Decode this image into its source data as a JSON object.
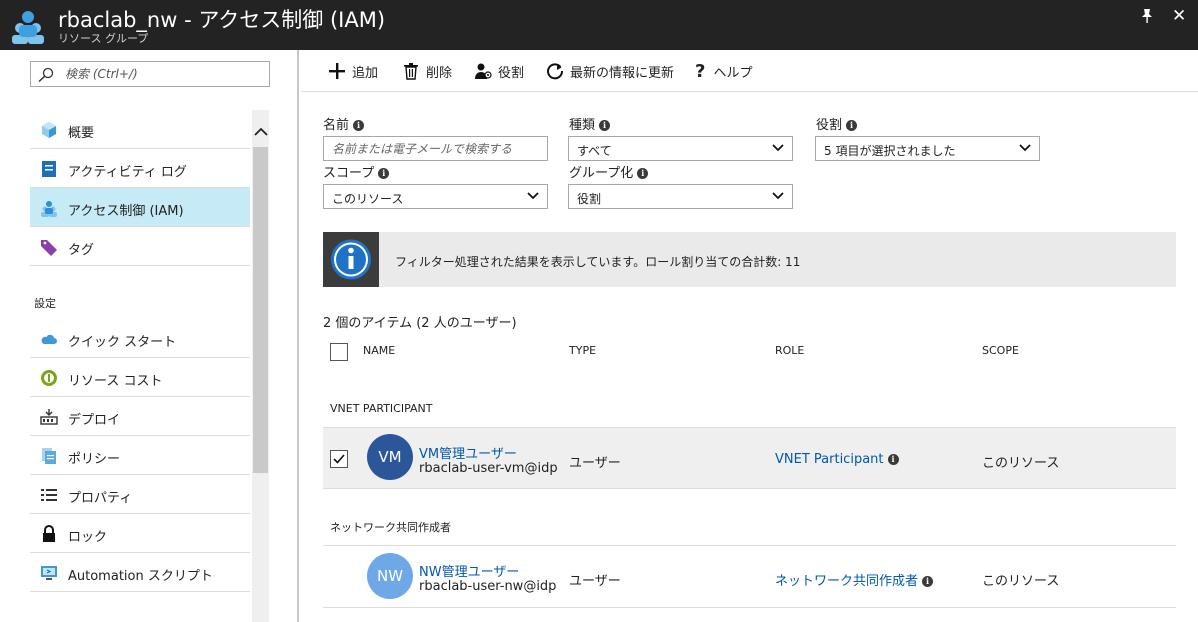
{
  "window": {
    "title": "rbaclab_nw - アクセス制御 (IAM)",
    "subtitle": "リソース グループ"
  },
  "search": {
    "placeholder": "検索 (Ctrl+/)"
  },
  "nav": {
    "items": [
      {
        "label": "概要",
        "icon": "cube-icon"
      },
      {
        "label": "アクティビティ ログ",
        "icon": "activity-log-icon"
      },
      {
        "label": "アクセス制御 (IAM)",
        "icon": "users-icon",
        "active": true
      },
      {
        "label": "タグ",
        "icon": "tag-icon"
      }
    ],
    "section": "設定",
    "settings_items": [
      {
        "label": "クイック スタート",
        "icon": "cloud-icon"
      },
      {
        "label": "リソース コスト",
        "icon": "cost-icon"
      },
      {
        "label": "デプロイ",
        "icon": "deploy-icon"
      },
      {
        "label": "ポリシー",
        "icon": "policy-icon"
      },
      {
        "label": "プロパティ",
        "icon": "properties-icon"
      },
      {
        "label": "ロック",
        "icon": "lock-icon"
      },
      {
        "label": "Automation スクリプト",
        "icon": "automation-icon"
      }
    ]
  },
  "toolbar": {
    "add": "追加",
    "delete": "削除",
    "roles": "役割",
    "refresh": "最新の情報に更新",
    "help": "ヘルプ"
  },
  "filters": {
    "name_label": "名前",
    "name_placeholder": "名前または電子メールで検索する",
    "type_label": "種類",
    "type_value": "すべて",
    "role_label": "役割",
    "role_value": "5 項目が選択されました",
    "scope_label": "スコープ",
    "scope_value": "このリソース",
    "group_label": "グループ化",
    "group_value": "役割"
  },
  "banner": {
    "text": "フィルター処理された結果を表示しています。ロール割り当ての合計数: 11"
  },
  "count": "2 個のアイテム (2 人のユーザー)",
  "table": {
    "headers": {
      "name": "NAME",
      "type": "TYPE",
      "role": "ROLE",
      "scope": "SCOPE"
    },
    "groups": [
      {
        "label": "VNET PARTICIPANT",
        "rows": [
          {
            "initials": "VM",
            "name": "VM管理ユーザー",
            "email": "rbaclab-user-vm@idp",
            "type": "ユーザー",
            "role": "VNET Participant",
            "scope": "このリソース",
            "checked": true,
            "color": "#2b579a"
          }
        ]
      },
      {
        "label": "ネットワーク共同作成者",
        "rows": [
          {
            "initials": "NW",
            "name": "NW管理ユーザー",
            "email": "rbaclab-user-nw@idp",
            "type": "ユーザー",
            "role": "ネットワーク共同作成者",
            "scope": "このリソース",
            "checked": false,
            "color": "#6ea8e6"
          }
        ]
      }
    ]
  }
}
